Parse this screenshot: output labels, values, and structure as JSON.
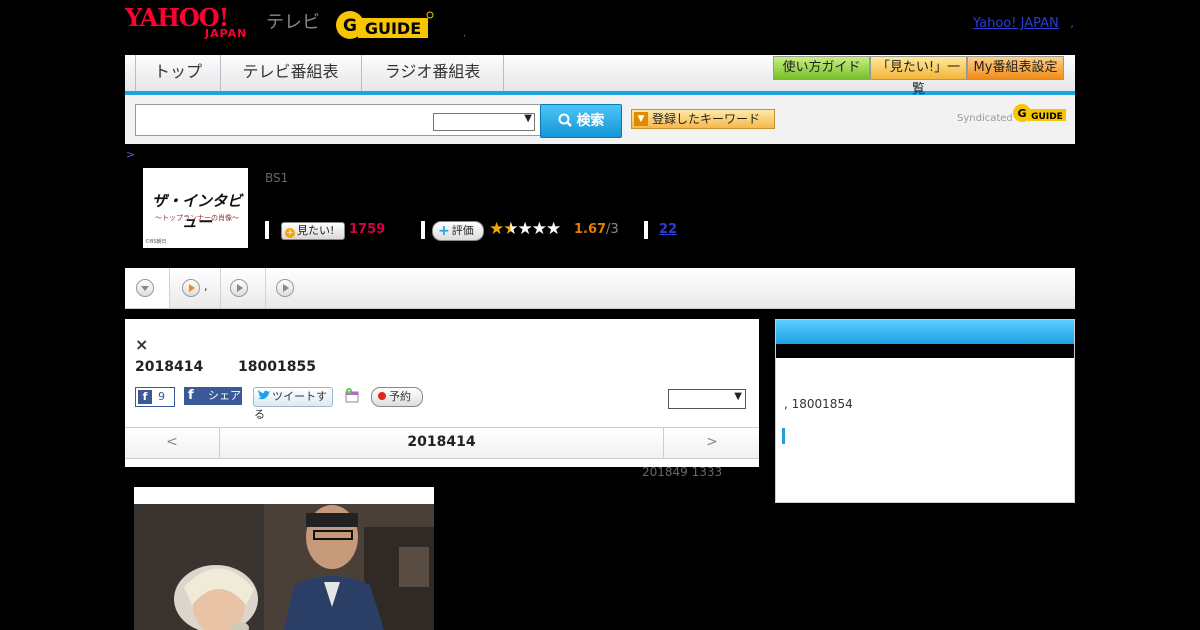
{
  "header": {
    "logo_yahoo": "YAHOO!",
    "logo_japan": "JAPAN",
    "logo_tv": "テレビ",
    "logo_gguide": "GUIDE",
    "dot": ",",
    "yahoo_japan_link": "Yahoo! JAPAN",
    "comma": ","
  },
  "nav": {
    "tabs": [
      {
        "label": "トップ"
      },
      {
        "label": "テレビ番組表"
      },
      {
        "label": "ラジオ番組表"
      }
    ],
    "guide_buttons": [
      {
        "label": "使い方ガイド"
      },
      {
        "label": "「見たい!」一覧"
      },
      {
        "label": "My番組表設定"
      }
    ]
  },
  "search": {
    "button_label": "検索",
    "keyword_button": "登録したキーワード",
    "syndicated": "Syndicated",
    "syndicated_logo": "GUIDE"
  },
  "program": {
    "breadcrumb": ">",
    "thumb_title": "ザ・インタビュー",
    "thumb_sub": "〜トップランナーの肖像〜",
    "thumb_copy": "©BS朝日",
    "channel": "BS1",
    "mitai_label": "見たい!",
    "mitai_count": "1759",
    "hyoka_label": "評価",
    "rating": "1.67",
    "rating_max": "/3",
    "reviews": "22"
  },
  "tabstrip": {
    "comma": ","
  },
  "main": {
    "close": "×",
    "date": "2018414",
    "time": "18001855",
    "fb_count": "9",
    "fb_share": "シェア",
    "tweet": "ツイートする",
    "yoyaku": "予約",
    "prev": "<",
    "nav_date": "2018414",
    "next": ">",
    "updated": "201849  1333"
  },
  "side": {
    "text": ", 18001854"
  },
  "colors": {
    "accent": "#1ea2e6",
    "brand_red": "#ff0033",
    "gguide_yellow": "#f7c600",
    "mitai_pink": "#d8004c",
    "rating_orange": "#e37b00"
  }
}
